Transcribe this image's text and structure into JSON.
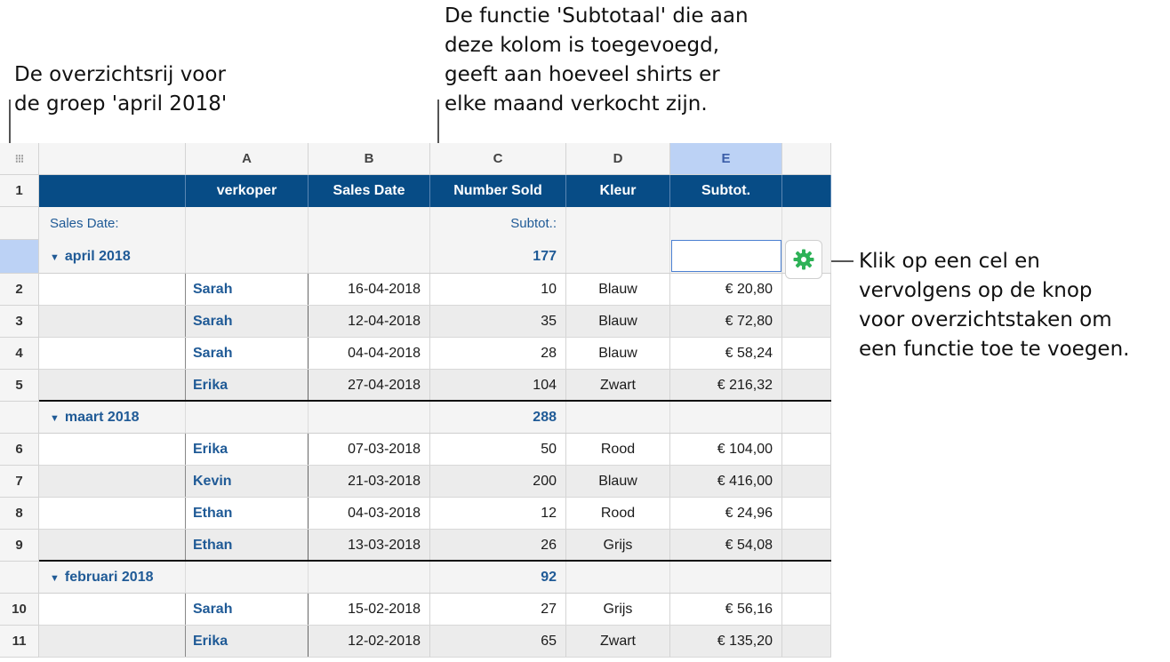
{
  "callouts": {
    "summary_row": "De overzichtsrij voor\nde groep 'april 2018'",
    "subtotal_function": "De functie 'Subtotaal' die aan\ndeze kolom is toegevoegd,\ngeeft aan hoeveel shirts er\nelke maand verkocht zijn.",
    "click_cell": "Klik op een cel en\nvervolgens op de knop\nvoor overzichtstaken om\neen functie toe te voegen."
  },
  "column_letters": [
    "A",
    "B",
    "C",
    "D",
    "E"
  ],
  "selected_column": "E",
  "table_headers": [
    "verkoper",
    "Sales Date",
    "Number Sold",
    "Kleur",
    "Subtot."
  ],
  "header_row_number": "1",
  "summary_label": "Sales Date:",
  "subtotal_label": "Subtot.:",
  "groups": [
    {
      "name": "april 2018",
      "total": "177",
      "rows": [
        {
          "n": "2",
          "seller": "Sarah",
          "date": "16-04-2018",
          "sold": "10",
          "color": "Blauw",
          "subtot": "€ 20,80"
        },
        {
          "n": "3",
          "seller": "Sarah",
          "date": "12-04-2018",
          "sold": "35",
          "color": "Blauw",
          "subtot": "€ 72,80"
        },
        {
          "n": "4",
          "seller": "Sarah",
          "date": "04-04-2018",
          "sold": "28",
          "color": "Blauw",
          "subtot": "€ 58,24"
        },
        {
          "n": "5",
          "seller": "Erika",
          "date": "27-04-2018",
          "sold": "104",
          "color": "Zwart",
          "subtot": "€ 216,32"
        }
      ]
    },
    {
      "name": "maart 2018",
      "total": "288",
      "rows": [
        {
          "n": "6",
          "seller": "Erika",
          "date": "07-03-2018",
          "sold": "50",
          "color": "Rood",
          "subtot": "€ 104,00"
        },
        {
          "n": "7",
          "seller": "Kevin",
          "date": "21-03-2018",
          "sold": "200",
          "color": "Blauw",
          "subtot": "€ 416,00"
        },
        {
          "n": "8",
          "seller": "Ethan",
          "date": "04-03-2018",
          "sold": "12",
          "color": "Rood",
          "subtot": "€ 24,96"
        },
        {
          "n": "9",
          "seller": "Ethan",
          "date": "13-03-2018",
          "sold": "26",
          "color": "Grijs",
          "subtot": "€ 54,08"
        }
      ]
    },
    {
      "name": "februari 2018",
      "total": "92",
      "rows": [
        {
          "n": "10",
          "seller": "Sarah",
          "date": "15-02-2018",
          "sold": "27",
          "color": "Grijs",
          "subtot": "€ 56,16"
        },
        {
          "n": "11",
          "seller": "Erika",
          "date": "12-02-2018",
          "sold": "65",
          "color": "Zwart",
          "subtot": "€ 135,20"
        }
      ]
    }
  ],
  "icons": {
    "corner": "grid-dots-icon",
    "gear": "gear-icon",
    "collapse": "triangle-down-icon"
  },
  "colors": {
    "header_blue": "#074c86",
    "text_blue": "#1f5a96",
    "selection": "#bcd2f5",
    "gear_green": "#2eb257"
  }
}
